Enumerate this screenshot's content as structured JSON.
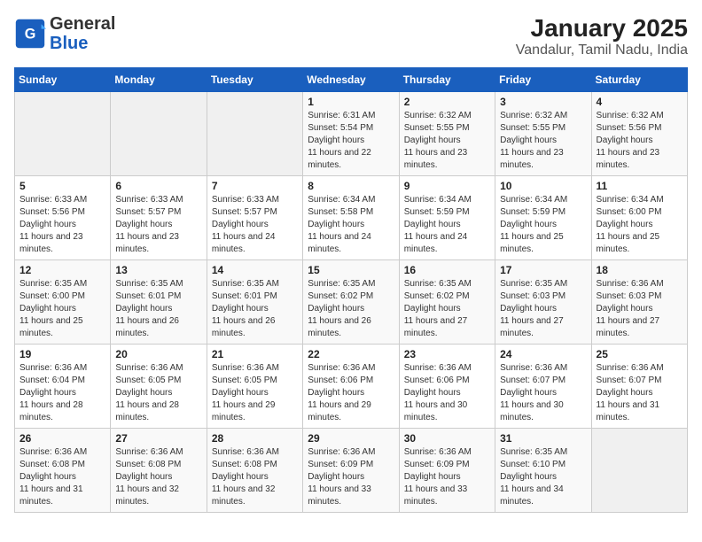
{
  "header": {
    "logo_general": "General",
    "logo_blue": "Blue",
    "title": "January 2025",
    "subtitle": "Vandalur, Tamil Nadu, India"
  },
  "calendar": {
    "days_of_week": [
      "Sunday",
      "Monday",
      "Tuesday",
      "Wednesday",
      "Thursday",
      "Friday",
      "Saturday"
    ],
    "weeks": [
      [
        {
          "day": "",
          "empty": true
        },
        {
          "day": "",
          "empty": true
        },
        {
          "day": "",
          "empty": true
        },
        {
          "day": "1",
          "sunrise": "6:31 AM",
          "sunset": "5:54 PM",
          "daylight": "11 hours and 22 minutes."
        },
        {
          "day": "2",
          "sunrise": "6:32 AM",
          "sunset": "5:55 PM",
          "daylight": "11 hours and 23 minutes."
        },
        {
          "day": "3",
          "sunrise": "6:32 AM",
          "sunset": "5:55 PM",
          "daylight": "11 hours and 23 minutes."
        },
        {
          "day": "4",
          "sunrise": "6:32 AM",
          "sunset": "5:56 PM",
          "daylight": "11 hours and 23 minutes."
        }
      ],
      [
        {
          "day": "5",
          "sunrise": "6:33 AM",
          "sunset": "5:56 PM",
          "daylight": "11 hours and 23 minutes."
        },
        {
          "day": "6",
          "sunrise": "6:33 AM",
          "sunset": "5:57 PM",
          "daylight": "11 hours and 23 minutes."
        },
        {
          "day": "7",
          "sunrise": "6:33 AM",
          "sunset": "5:57 PM",
          "daylight": "11 hours and 24 minutes."
        },
        {
          "day": "8",
          "sunrise": "6:34 AM",
          "sunset": "5:58 PM",
          "daylight": "11 hours and 24 minutes."
        },
        {
          "day": "9",
          "sunrise": "6:34 AM",
          "sunset": "5:59 PM",
          "daylight": "11 hours and 24 minutes."
        },
        {
          "day": "10",
          "sunrise": "6:34 AM",
          "sunset": "5:59 PM",
          "daylight": "11 hours and 25 minutes."
        },
        {
          "day": "11",
          "sunrise": "6:34 AM",
          "sunset": "6:00 PM",
          "daylight": "11 hours and 25 minutes."
        }
      ],
      [
        {
          "day": "12",
          "sunrise": "6:35 AM",
          "sunset": "6:00 PM",
          "daylight": "11 hours and 25 minutes."
        },
        {
          "day": "13",
          "sunrise": "6:35 AM",
          "sunset": "6:01 PM",
          "daylight": "11 hours and 26 minutes."
        },
        {
          "day": "14",
          "sunrise": "6:35 AM",
          "sunset": "6:01 PM",
          "daylight": "11 hours and 26 minutes."
        },
        {
          "day": "15",
          "sunrise": "6:35 AM",
          "sunset": "6:02 PM",
          "daylight": "11 hours and 26 minutes."
        },
        {
          "day": "16",
          "sunrise": "6:35 AM",
          "sunset": "6:02 PM",
          "daylight": "11 hours and 27 minutes."
        },
        {
          "day": "17",
          "sunrise": "6:35 AM",
          "sunset": "6:03 PM",
          "daylight": "11 hours and 27 minutes."
        },
        {
          "day": "18",
          "sunrise": "6:36 AM",
          "sunset": "6:03 PM",
          "daylight": "11 hours and 27 minutes."
        }
      ],
      [
        {
          "day": "19",
          "sunrise": "6:36 AM",
          "sunset": "6:04 PM",
          "daylight": "11 hours and 28 minutes."
        },
        {
          "day": "20",
          "sunrise": "6:36 AM",
          "sunset": "6:05 PM",
          "daylight": "11 hours and 28 minutes."
        },
        {
          "day": "21",
          "sunrise": "6:36 AM",
          "sunset": "6:05 PM",
          "daylight": "11 hours and 29 minutes."
        },
        {
          "day": "22",
          "sunrise": "6:36 AM",
          "sunset": "6:06 PM",
          "daylight": "11 hours and 29 minutes."
        },
        {
          "day": "23",
          "sunrise": "6:36 AM",
          "sunset": "6:06 PM",
          "daylight": "11 hours and 30 minutes."
        },
        {
          "day": "24",
          "sunrise": "6:36 AM",
          "sunset": "6:07 PM",
          "daylight": "11 hours and 30 minutes."
        },
        {
          "day": "25",
          "sunrise": "6:36 AM",
          "sunset": "6:07 PM",
          "daylight": "11 hours and 31 minutes."
        }
      ],
      [
        {
          "day": "26",
          "sunrise": "6:36 AM",
          "sunset": "6:08 PM",
          "daylight": "11 hours and 31 minutes."
        },
        {
          "day": "27",
          "sunrise": "6:36 AM",
          "sunset": "6:08 PM",
          "daylight": "11 hours and 32 minutes."
        },
        {
          "day": "28",
          "sunrise": "6:36 AM",
          "sunset": "6:08 PM",
          "daylight": "11 hours and 32 minutes."
        },
        {
          "day": "29",
          "sunrise": "6:36 AM",
          "sunset": "6:09 PM",
          "daylight": "11 hours and 33 minutes."
        },
        {
          "day": "30",
          "sunrise": "6:36 AM",
          "sunset": "6:09 PM",
          "daylight": "11 hours and 33 minutes."
        },
        {
          "day": "31",
          "sunrise": "6:35 AM",
          "sunset": "6:10 PM",
          "daylight": "11 hours and 34 minutes."
        },
        {
          "day": "",
          "empty": true
        }
      ]
    ]
  }
}
